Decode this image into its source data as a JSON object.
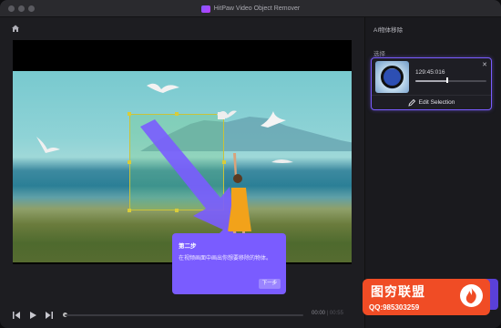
{
  "window": {
    "title": "HitPaw Video Object Remover"
  },
  "player": {
    "time_current": "00:00",
    "time_separator": " | ",
    "time_total": "00:55",
    "progress_fraction": 0.0
  },
  "tooltip": {
    "step_title": "第二步",
    "body": "在视频画面中画出你想要移除的物体。",
    "next_label": "下一步"
  },
  "sidebar": {
    "header": "AI物体移除",
    "section_label": "选择",
    "selection_card": {
      "time": "129:45:016",
      "close_symbol": "✕",
      "slider_fraction": 0.45,
      "edit_label": "Edit Selection"
    }
  },
  "watermark": {
    "name": "图穷联盟",
    "contact": "QQ:985303259"
  },
  "colors": {
    "accent": "#7a5cff",
    "watermark": "#f04c25",
    "selection_border": "#c9c33a"
  }
}
